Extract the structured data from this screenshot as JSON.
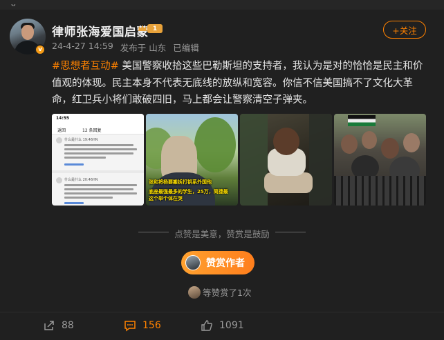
{
  "top_strip": {
    "text": "ᴗ"
  },
  "author": {
    "name": "律师张海爱国启蒙",
    "level": "1",
    "verified_mark": "v"
  },
  "meta": {
    "date": "24-4-27 14:59",
    "source": "发布于 山东",
    "edited": "已编辑"
  },
  "follow_label": "+关注",
  "post": {
    "hashtag": "#思想者互动#",
    "body": " 美国警察收拾这些巴勒斯坦的支持者，我认为是对的恰恰是民主和价值观的体现。民主本身不代表无底线的放纵和宽容。你信不信美国搞不了文化大革命，红卫兵小将们敢破四旧，马上都会让警察清空子弹夹。"
  },
  "image1": {
    "time": "14:55",
    "back": "返回",
    "title": "12 条回复",
    "user1": "什么是什么 19:46HN",
    "user2": "什么是什么 20:46HN"
  },
  "image2": {
    "caption1": "张和将杨要搬拆打钥系外国他",
    "caption2": "底座最强最多的学生，25万，简捷最",
    "caption3": "这个举个体在哭"
  },
  "tip_text": "点赞是美意，赞赏是鼓励",
  "reward_label": "赞赏作者",
  "rewarders_text": "等赞赏了1次",
  "actions": {
    "share_count": "88",
    "comment_count": "156",
    "like_count": "1091"
  },
  "colors": {
    "accent": "#ff8200",
    "background": "#202020",
    "text": "#e6e6e6",
    "muted": "#9a9a9a"
  }
}
